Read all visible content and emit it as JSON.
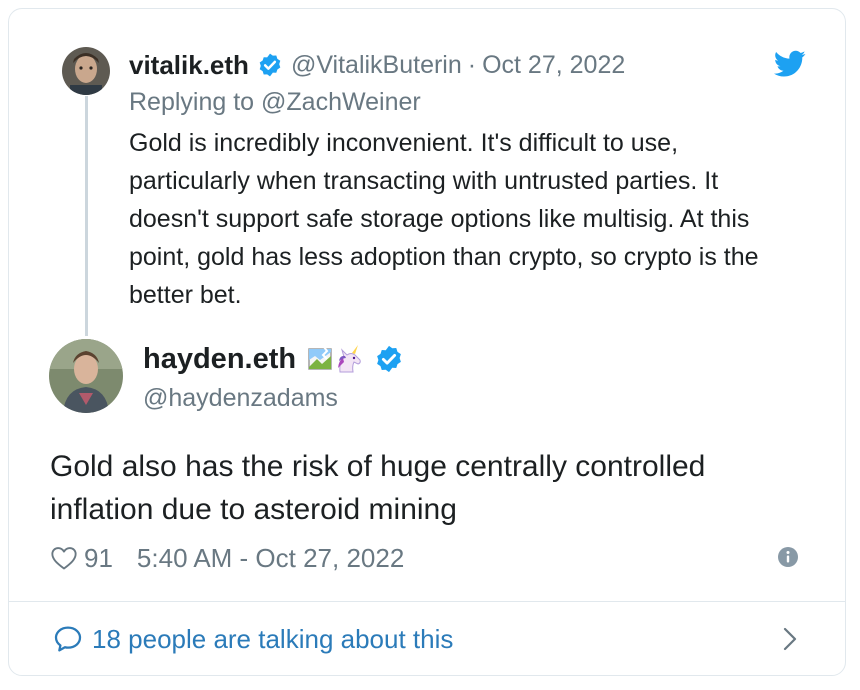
{
  "parent_tweet": {
    "author_name": "vitalik.eth",
    "handle": "@VitalikButerin",
    "separator": "·",
    "date": "Oct 27, 2022",
    "replying_prefix": "Replying to",
    "replying_to": "@ZachWeiner",
    "text": "Gold is incredibly inconvenient. It's difficult to use, particularly when transacting with untrusted parties. It doesn't support safe storage options like multisig. At this point, gold has less adoption than crypto, so crypto is the better bet."
  },
  "tweet": {
    "author_name": "hayden.eth",
    "handle": "@haydenzadams",
    "text": "Gold also has the risk of huge centrally controlled inflation due to asteroid mining",
    "like_count": "91",
    "timestamp": "5:40 AM - Oct 27, 2022"
  },
  "footer": {
    "conversation_label": "18 people are talking about this"
  },
  "icons": {
    "brand": "twitter-bird-icon",
    "verified": "verified-badge-icon",
    "like": "heart-icon",
    "info": "info-icon",
    "reply": "speech-bubble-icon",
    "more": "chevron-right-icon",
    "emoji_1": "broken-image-icon",
    "emoji_2": "unicorn-icon"
  },
  "colors": {
    "twitter_blue": "#1da1f2",
    "link_blue": "#2b7bb9",
    "text": "#1c2022",
    "secondary_text": "#697882",
    "border": "#e1e8ed"
  }
}
